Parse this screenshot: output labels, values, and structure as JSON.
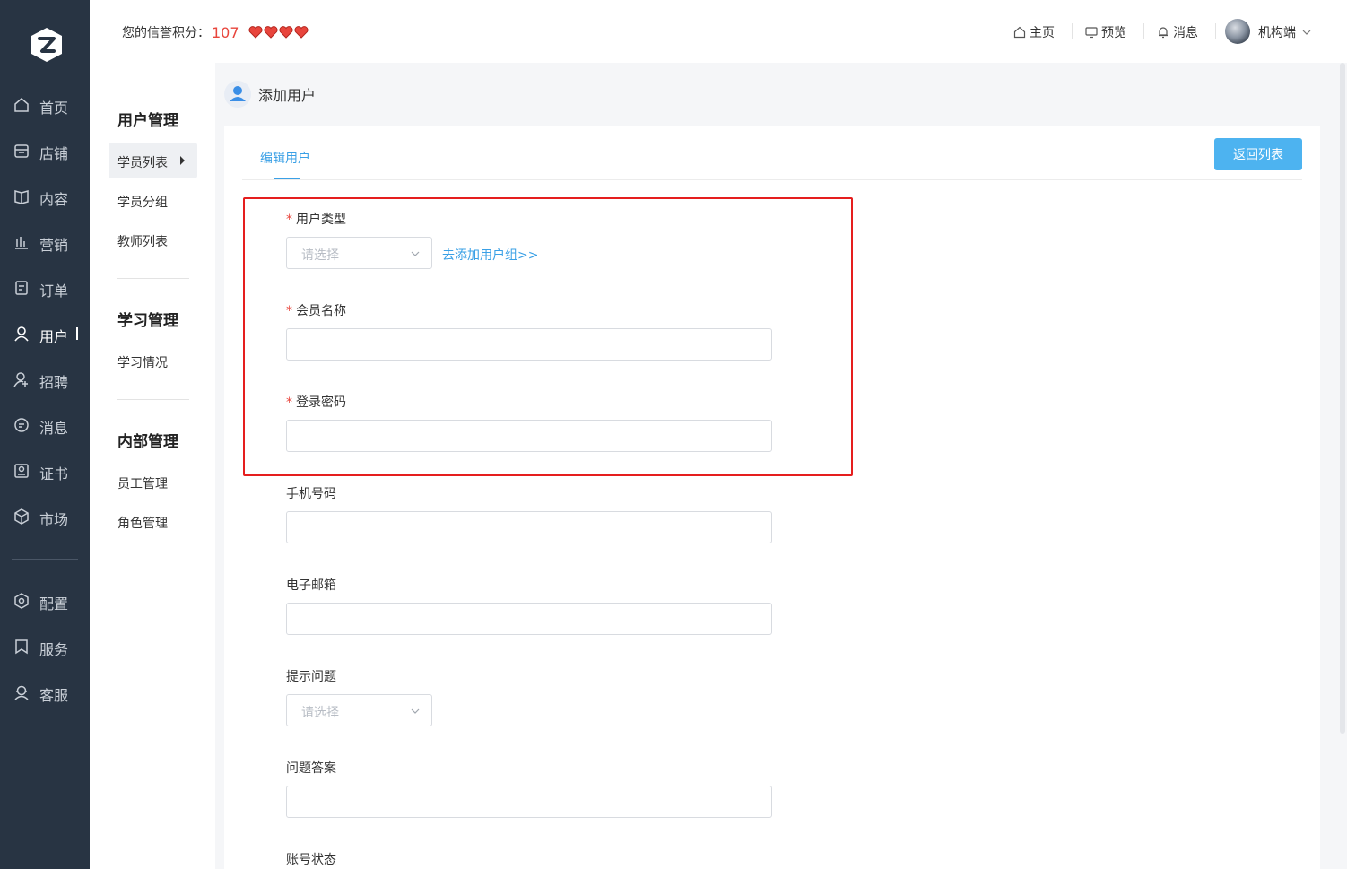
{
  "header": {
    "credit_label": "您的信誉积分：",
    "credit_score": "107",
    "hearts": 4,
    "home": "主页",
    "preview": "预览",
    "messages": "消息",
    "account": "机构端"
  },
  "sidenav": {
    "items": [
      {
        "label": "首页",
        "icon": "home-icon"
      },
      {
        "label": "店铺",
        "icon": "store-icon"
      },
      {
        "label": "内容",
        "icon": "book-icon"
      },
      {
        "label": "营销",
        "icon": "chart-icon"
      },
      {
        "label": "订单",
        "icon": "order-icon"
      },
      {
        "label": "用户",
        "icon": "user-icon",
        "active": true
      },
      {
        "label": "招聘",
        "icon": "recruit-icon"
      },
      {
        "label": "消息",
        "icon": "message-icon"
      },
      {
        "label": "证书",
        "icon": "certificate-icon"
      },
      {
        "label": "市场",
        "icon": "market-icon"
      },
      {
        "label": "配置",
        "icon": "gear-icon"
      },
      {
        "label": "服务",
        "icon": "bookmark-icon"
      },
      {
        "label": "客服",
        "icon": "support-icon"
      }
    ]
  },
  "subnav": {
    "group1": "用户管理",
    "student_list": "学员列表",
    "student_group": "学员分组",
    "teacher_list": "教师列表",
    "group2": "学习管理",
    "study_status": "学习情况",
    "group3": "内部管理",
    "staff": "员工管理",
    "roles": "角色管理"
  },
  "page": {
    "title": "添加用户",
    "tab": "编辑用户",
    "back_button": "返回列表"
  },
  "form": {
    "user_type": "用户类型",
    "select_placeholder": "请选择",
    "add_group_link": "去添加用户组>>",
    "member_name": "会员名称",
    "password": "登录密码",
    "phone": "手机号码",
    "email": "电子邮箱",
    "hint_question": "提示问题",
    "answer": "问题答案",
    "account_status": "账号状态",
    "required_mark": "*"
  },
  "colors": {
    "nav_bg": "#283443",
    "accent": "#3aa0e6",
    "button": "#4db3f0",
    "highlight": "#e51e1e",
    "score": "#e8453c"
  }
}
